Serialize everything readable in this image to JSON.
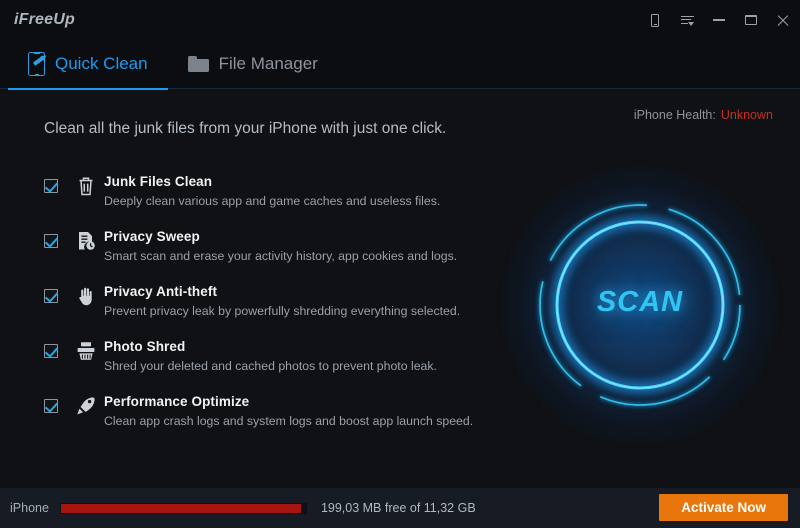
{
  "window": {
    "logo": "iFreeUp",
    "controls": [
      {
        "name": "device-icon",
        "label": "device"
      },
      {
        "name": "menu-icon",
        "label": "menu"
      },
      {
        "name": "minimize-button",
        "label": "minimize"
      },
      {
        "name": "maximize-button",
        "label": "maximize"
      },
      {
        "name": "close-button",
        "label": "close"
      }
    ]
  },
  "tabs": [
    {
      "label": "Quick Clean",
      "icon": "phone-brush-icon",
      "active": true
    },
    {
      "label": "File Manager",
      "icon": "folder-icon",
      "active": false
    }
  ],
  "main": {
    "headline": "Clean all the junk files from your iPhone with just one click.",
    "health_label": "iPhone Health:",
    "health_value": "Unknown",
    "health_color": "#c12f2a",
    "scan_label": "SCAN",
    "accent_color": "#2fc6f5"
  },
  "options": [
    {
      "title": "Junk Files Clean",
      "desc": "Deeply clean various app and game caches and useless files.",
      "icon": "trash-icon",
      "checked": true
    },
    {
      "title": "Privacy Sweep",
      "desc": "Smart scan and erase your activity history, app cookies and logs.",
      "icon": "document-clock-icon",
      "checked": true
    },
    {
      "title": "Privacy Anti-theft",
      "desc": "Prevent privacy leak by powerfully shredding everything selected.",
      "icon": "hand-stop-icon",
      "checked": true
    },
    {
      "title": "Photo Shred",
      "desc": "Shred your deleted and cached photos to prevent photo leak.",
      "icon": "shredder-icon",
      "checked": true
    },
    {
      "title": "Performance Optimize",
      "desc": "Clean app crash logs and system logs and boost app launch speed.",
      "icon": "rocket-icon",
      "checked": true
    }
  ],
  "status": {
    "device_label": "iPhone",
    "storage_text": "199,03 MB free of 11,32 GB",
    "used_percent": 98,
    "bar_color": "#a81511",
    "activate_label": "Activate Now",
    "activate_color": "#e8760d"
  }
}
